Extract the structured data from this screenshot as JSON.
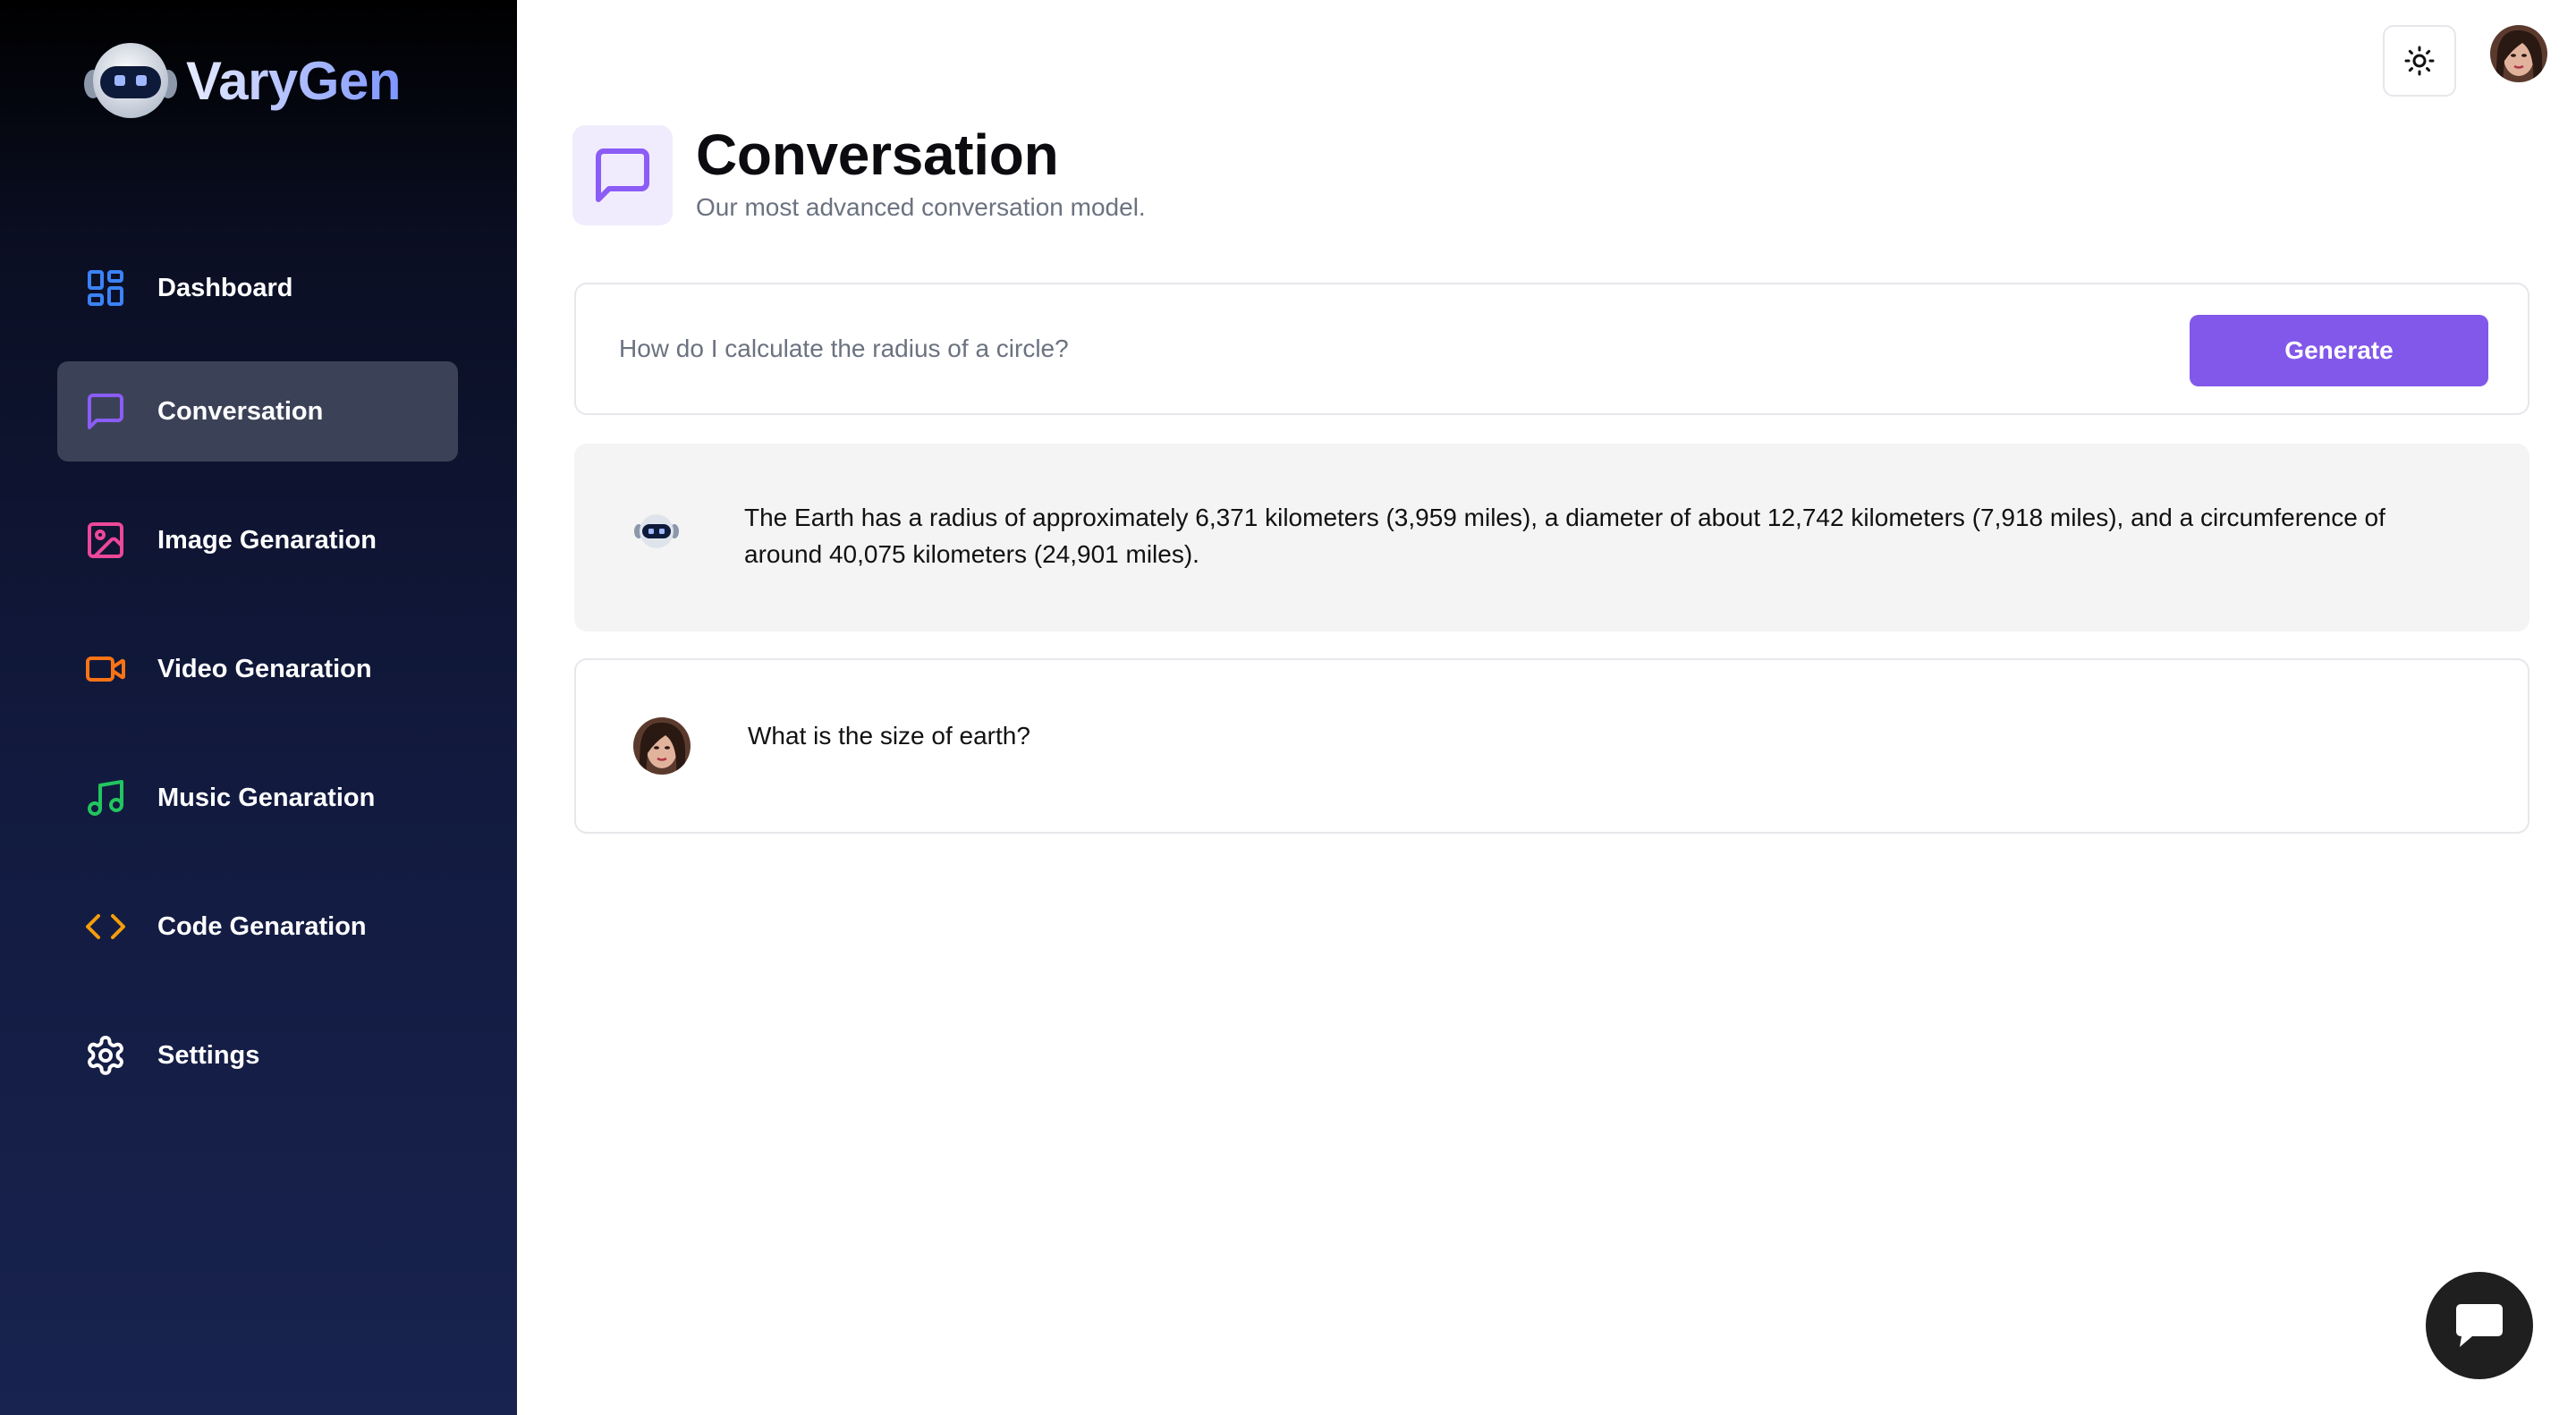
{
  "brand": {
    "name": "VaryGen",
    "logo_icon": "robot-head-icon"
  },
  "sidebar": {
    "items": [
      {
        "label": "Dashboard",
        "icon": "dashboard-grid-icon",
        "color": "#3b82f6",
        "active": false
      },
      {
        "label": "Conversation",
        "icon": "chat-bubble-icon",
        "color": "#8b5cf6",
        "active": true
      },
      {
        "label": "Image Genaration",
        "icon": "image-icon",
        "color": "#ec4899",
        "active": false
      },
      {
        "label": "Video Genaration",
        "icon": "video-camera-icon",
        "color": "#f97316",
        "active": false
      },
      {
        "label": "Music Genaration",
        "icon": "music-note-icon",
        "color": "#22c55e",
        "active": false
      },
      {
        "label": "Code Genaration",
        "icon": "code-brackets-icon",
        "color": "#f59e0b",
        "active": false
      },
      {
        "label": "Settings",
        "icon": "gear-icon",
        "color": "#ffffff",
        "active": false
      }
    ]
  },
  "topbar": {
    "theme_toggle_icon": "sun-icon",
    "avatar": "user-avatar"
  },
  "header": {
    "icon": "chat-bubble-icon",
    "title": "Conversation",
    "subtitle": "Our most advanced conversation model."
  },
  "prompt": {
    "placeholder": "How do I calculate the radius of a circle?",
    "value": "",
    "button_label": "Generate"
  },
  "messages": [
    {
      "role": "bot",
      "avatar": "robot-head-icon",
      "text": "The Earth has a radius of approximately 6,371 kilometers (3,959 miles), a diameter of about 12,742 kilometers (7,918 miles), and a circumference of around 40,075 kilometers (24,901 miles)."
    },
    {
      "role": "user",
      "avatar": "user-avatar",
      "text": "What is the size of earth?"
    }
  ],
  "support": {
    "icon": "chat-support-icon"
  },
  "colors": {
    "accent": "#8258ea",
    "sidebar_active": "#3b4257"
  }
}
